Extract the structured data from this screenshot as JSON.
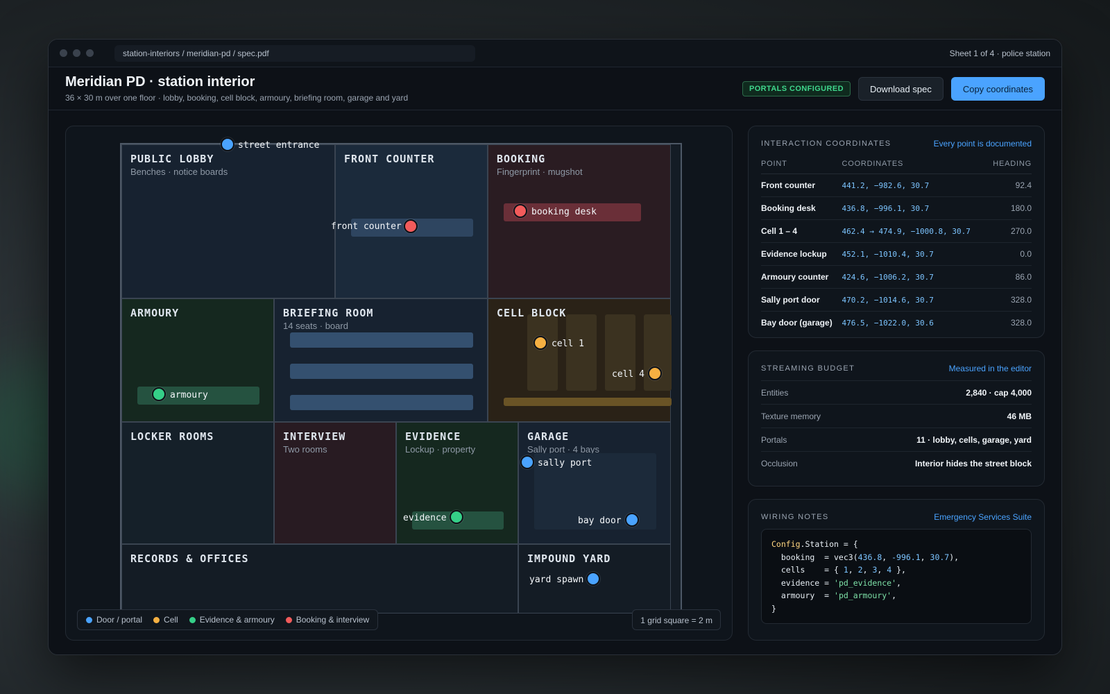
{
  "window": {
    "path": "station-interiors / meridian-pd / spec.pdf",
    "sheet": "Sheet 1 of 4 · police station"
  },
  "header": {
    "title": "Meridian PD · station interior",
    "subtitle": "36 × 30 m over one floor · lobby, booking, cell block, armoury, briefing room, garage and yard",
    "badge": "PORTALS CONFIGURED",
    "download_label": "Download spec",
    "copy_label": "Copy coordinates"
  },
  "map": {
    "rooms": {
      "lobby": {
        "title": "PUBLIC LOBBY",
        "sub": "Benches · notice boards"
      },
      "front_counter": {
        "title": "FRONT COUNTER"
      },
      "booking": {
        "title": "BOOKING",
        "sub": "Fingerprint · mugshot"
      },
      "armoury": {
        "title": "ARMOURY"
      },
      "briefing": {
        "title": "BRIEFING ROOM",
        "sub": "14 seats · board"
      },
      "cell_block": {
        "title": "CELL BLOCK"
      },
      "lockers": {
        "title": "LOCKER ROOMS"
      },
      "interview": {
        "title": "INTERVIEW",
        "sub": "Two rooms"
      },
      "evidence": {
        "title": "EVIDENCE",
        "sub": "Lockup · property"
      },
      "garage": {
        "title": "GARAGE",
        "sub": "Sally port · 4 bays"
      },
      "records": {
        "title": "RECORDS & OFFICES"
      },
      "impound": {
        "title": "IMPOUND YARD"
      }
    },
    "points": {
      "street_entrance": "street entrance",
      "front_counter": "front counter",
      "booking_desk": "booking desk",
      "cell1": "cell 1",
      "cell4": "cell 4",
      "armoury": "armoury",
      "sally_port": "sally port",
      "bay_door": "bay door",
      "evidence": "evidence",
      "yard_spawn": "yard spawn"
    },
    "legend": {
      "door": "Door / portal",
      "cell": "Cell",
      "evidence": "Evidence & armoury",
      "booking": "Booking & interview"
    },
    "scale": "1 grid square = 2 m",
    "colors": {
      "door": "#4aa3ff",
      "cell": "#f5b042",
      "evidence": "#35cf88",
      "booking": "#f25b5b"
    }
  },
  "coords": {
    "title": "INTERACTION COORDINATES",
    "link": "Every point is documented",
    "headers": {
      "point": "POINT",
      "coordinates": "COORDINATES",
      "heading": "HEADING"
    },
    "rows": [
      {
        "point": "Front counter",
        "coordinates": "441.2, −982.6, 30.7",
        "heading": "92.4"
      },
      {
        "point": "Booking desk",
        "coordinates": "436.8, −996.1, 30.7",
        "heading": "180.0"
      },
      {
        "point": "Cell 1 – 4",
        "coordinates": "462.4 → 474.9, −1000.8, 30.7",
        "heading": "270.0"
      },
      {
        "point": "Evidence lockup",
        "coordinates": "452.1, −1010.4, 30.7",
        "heading": "0.0"
      },
      {
        "point": "Armoury counter",
        "coordinates": "424.6, −1006.2, 30.7",
        "heading": "86.0"
      },
      {
        "point": "Sally port door",
        "coordinates": "470.2, −1014.6, 30.7",
        "heading": "328.0"
      },
      {
        "point": "Bay door (garage)",
        "coordinates": "476.5, −1022.0, 30.6",
        "heading": "328.0"
      }
    ]
  },
  "budget": {
    "title": "STREAMING BUDGET",
    "link": "Measured in the editor",
    "rows": [
      {
        "key": "Entities",
        "value": "2,840 · cap 4,000"
      },
      {
        "key": "Texture memory",
        "value": "46 MB"
      },
      {
        "key": "Portals",
        "value": "11 · lobby, cells, garage, yard"
      },
      {
        "key": "Occlusion",
        "value": "Interior hides the street block"
      }
    ]
  },
  "wiring": {
    "title": "WIRING NOTES",
    "link": "Emergency Services Suite",
    "code": {
      "l1a": "Config",
      "l1b": ".Station = {",
      "l2a": "  booking  = vec3(",
      "l2b": "436.8",
      "l2c": ", ",
      "l2d": "-996.1",
      "l2e": ", ",
      "l2f": "30.7",
      "l2g": "),",
      "l3a": "  cells    = { ",
      "l3b": "1",
      "l3c": ", ",
      "l3d": "2",
      "l3e": ", ",
      "l3f": "3",
      "l3g": ", ",
      "l3h": "4",
      "l3i": " },",
      "l4a": "  evidence = ",
      "l4b": "'pd_evidence'",
      "l4c": ",",
      "l5a": "  armoury  = ",
      "l5b": "'pd_armoury'",
      "l5c": ",",
      "l6a": "}"
    }
  }
}
